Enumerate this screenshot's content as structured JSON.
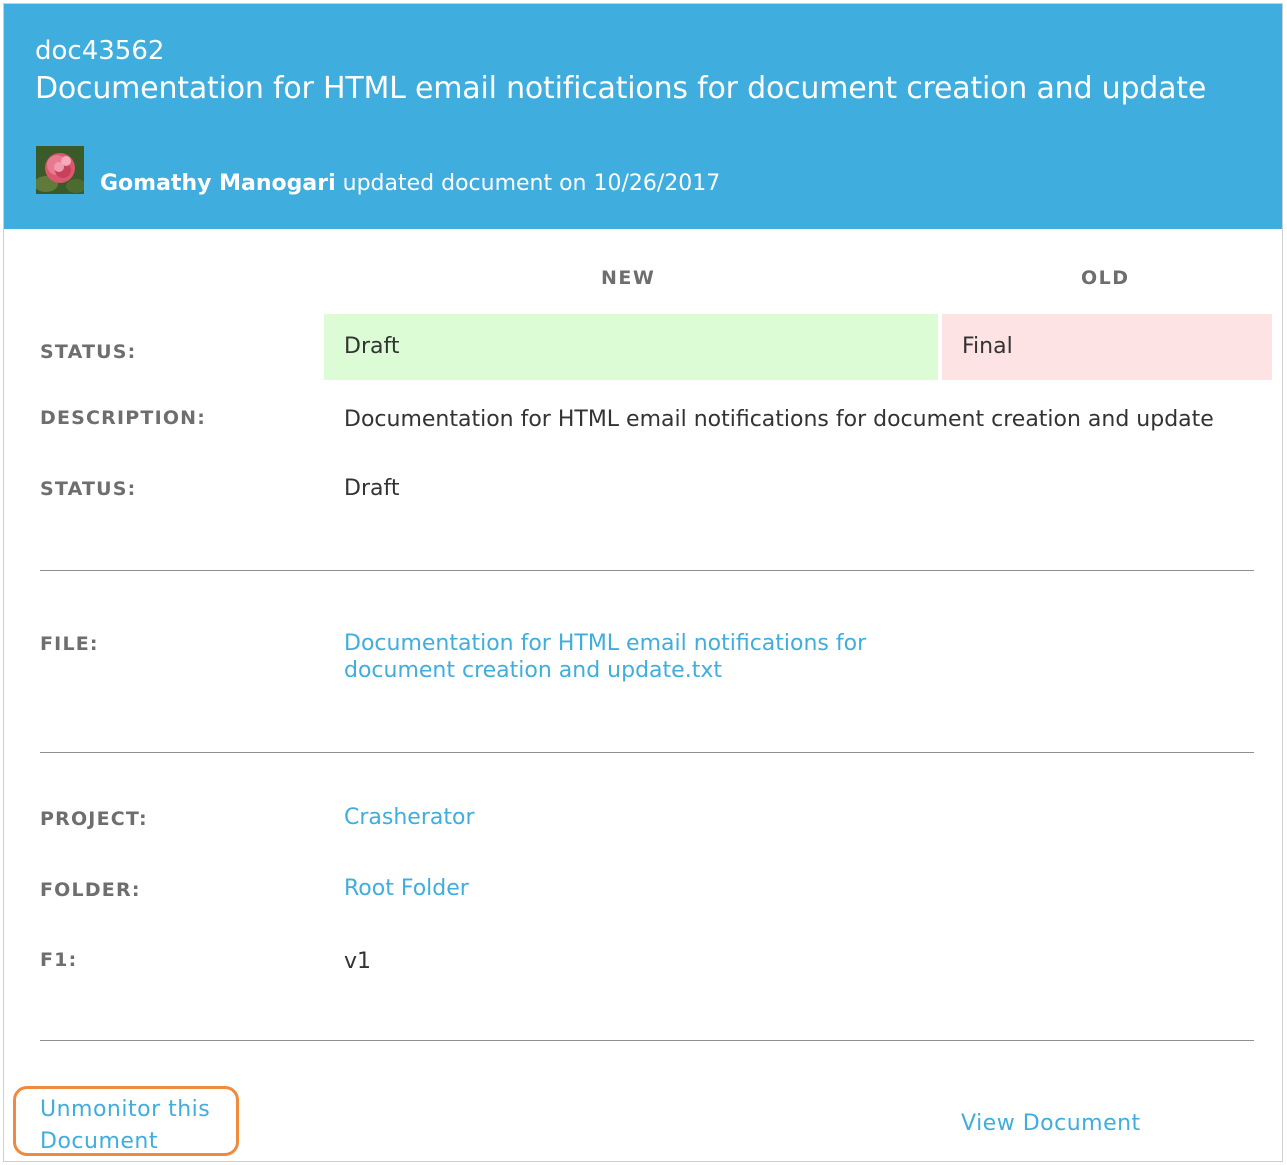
{
  "header": {
    "doc_id": "doc43562",
    "title": "Documentation for HTML email notifications for document creation and update",
    "author": "Gomathy Manogari",
    "action_text": "updated document on 10/26/2017"
  },
  "columns": {
    "new": "NEW",
    "old": "OLD"
  },
  "changes": {
    "status_label": "STATUS:",
    "status_new": "Draft",
    "status_old": "Final"
  },
  "details": {
    "description_label": "DESCRIPTION:",
    "description_value": "Documentation for HTML email notifications for document creation and update",
    "status_label": "STATUS:",
    "status_value": "Draft"
  },
  "file": {
    "label": "FILE:",
    "line1": "Documentation for HTML email notifications for",
    "line2": "document creation and update.txt"
  },
  "meta": {
    "project_label": "PROJECT:",
    "project_value": "Crasherator",
    "folder_label": "FOLDER:",
    "folder_value": "Root Folder",
    "f1_label": "F1:",
    "f1_value": "v1"
  },
  "footer": {
    "unmonitor_line1": "Unmonitor this",
    "unmonitor_line2": "Document",
    "view_document": "View Document"
  },
  "colors": {
    "header_bg": "#3fadde",
    "link": "#3fadde",
    "new_cell_bg": "#dcfcd6",
    "old_cell_bg": "#fde3e3",
    "highlight": "#f08a3c"
  }
}
